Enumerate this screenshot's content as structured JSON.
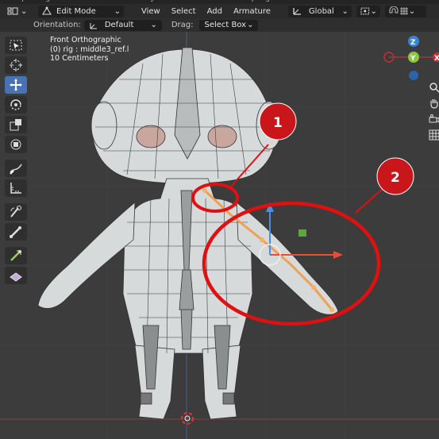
{
  "header": {
    "mode": "Edit Mode",
    "menu": [
      "View",
      "Select",
      "Add",
      "Armature"
    ],
    "transform_orientation": "Global"
  },
  "subheader": {
    "orientation_label": "Orientation:",
    "orientation_value": "Default",
    "drag_label": "Drag:",
    "drag_value": "Select Box"
  },
  "viewport": {
    "view_name": "Front Orthographic",
    "object_info": "(0) rig : middle3_ref.l",
    "grid_scale": "10 Centimeters"
  },
  "gizmo": {
    "z_label": "Z",
    "y_label": "Y",
    "x_label": "X"
  },
  "annotations": [
    {
      "number": "1"
    },
    {
      "number": "2"
    }
  ],
  "colors": {
    "accent_blue": "#4772b3",
    "annotation_red": "#e01010",
    "bone_orange": "#f0a050",
    "mesh_white": "#d8dcdc"
  },
  "toolbar_icons": [
    "select-box-icon",
    "cursor-icon",
    "move-icon",
    "rotate-icon",
    "scale-icon",
    "transform-icon",
    "annotate-icon",
    "measure-icon",
    "roll-icon",
    "bone-size-icon",
    "extrude-icon",
    "envelope-icon"
  ]
}
